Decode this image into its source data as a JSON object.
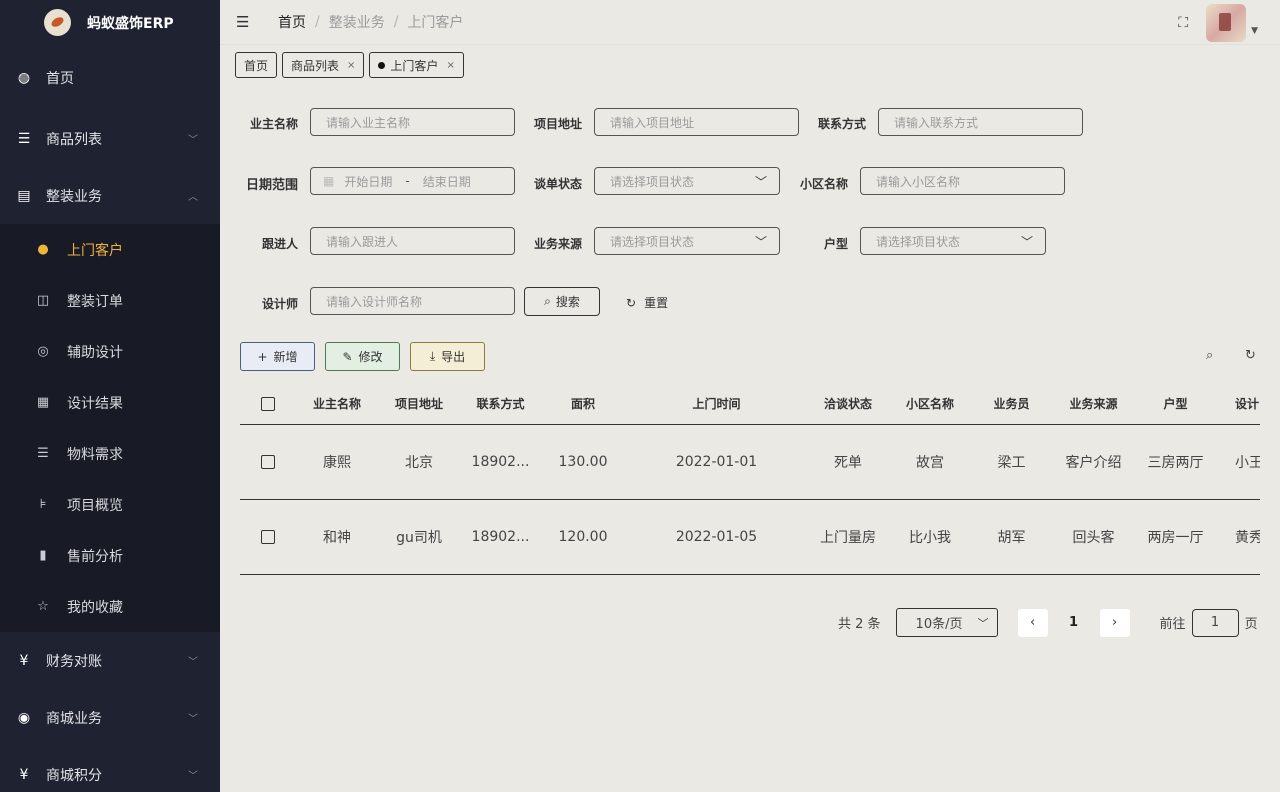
{
  "app": {
    "title": "蚂蚁盛饰ERP"
  },
  "sidebar": {
    "items": [
      {
        "label": "首页",
        "icon": "dashboard-icon",
        "arrow": ""
      },
      {
        "label": "商品列表",
        "icon": "list-icon",
        "arrow": "﹀"
      },
      {
        "label": "整装业务",
        "icon": "document-icon",
        "arrow": "︿"
      }
    ],
    "submenu": [
      {
        "label": "上门客户",
        "icon": "user-icon",
        "active": true
      },
      {
        "label": "整装订单",
        "icon": "book-icon"
      },
      {
        "label": "辅助设计",
        "icon": "palette-icon"
      },
      {
        "label": "设计结果",
        "icon": "grid-icon"
      },
      {
        "label": "物料需求",
        "icon": "list-icon"
      },
      {
        "label": "项目概览",
        "icon": "tree-icon"
      },
      {
        "label": "售前分析",
        "icon": "bar-chart-icon"
      },
      {
        "label": "我的收藏",
        "icon": "star-icon"
      }
    ],
    "items_after": [
      {
        "label": "财务对账",
        "icon": "yen-icon",
        "arrow": "﹀"
      },
      {
        "label": "商城业务",
        "icon": "globe-icon",
        "arrow": "﹀"
      },
      {
        "label": "商城积分",
        "icon": "yen-icon",
        "arrow": "﹀"
      }
    ]
  },
  "header": {
    "breadcrumb": [
      "首页",
      "整装业务",
      "上门客户"
    ]
  },
  "tags": [
    {
      "label": "首页"
    },
    {
      "label": "商品列表",
      "close": "×"
    },
    {
      "label": "上门客户",
      "close": "×",
      "active": true
    }
  ],
  "filters": {
    "owner_name": {
      "label": "业主名称",
      "placeholder": "请输入业主名称"
    },
    "project_address": {
      "label": "项目地址",
      "placeholder": "请输入项目地址"
    },
    "contact": {
      "label": "联系方式",
      "placeholder": "请输入联系方式"
    },
    "date_range": {
      "label": "日期范围",
      "start": "开始日期",
      "sep": "-",
      "end": "结束日期"
    },
    "deal_status": {
      "label": "谈单状态",
      "placeholder": "请选择项目状态"
    },
    "community": {
      "label": "小区名称",
      "placeholder": "请输入小区名称"
    },
    "follower": {
      "label": "跟进人",
      "placeholder": "请输入跟进人"
    },
    "source": {
      "label": "业务来源",
      "placeholder": "请选择项目状态"
    },
    "house_type": {
      "label": "户型",
      "placeholder": "请选择项目状态"
    },
    "designer": {
      "label": "设计师",
      "placeholder": "请输入设计师名称"
    },
    "search_label": "搜索",
    "reset_label": "重置"
  },
  "toolbar": {
    "add": "新增",
    "edit": "修改",
    "export": "导出"
  },
  "table": {
    "columns": [
      "业主名称",
      "项目地址",
      "联系方式",
      "面积",
      "上门时间",
      "洽谈状态",
      "小区名称",
      "业务员",
      "业务来源",
      "户型",
      "设计"
    ],
    "rows": [
      [
        "康熙",
        "北京",
        "18902...",
        "130.00",
        "2022-01-01",
        "死单",
        "故宫",
        "梁工",
        "客户介绍",
        "三房两厅",
        "小王"
      ],
      [
        "和神",
        "gu司机",
        "18902...",
        "120.00",
        "2022-01-05",
        "上门量房",
        "比小我",
        "胡军",
        "回头客",
        "两房一厅",
        "黄秀"
      ]
    ]
  },
  "pagination": {
    "total": "共 2 条",
    "page_size": "10条/页",
    "current": "1",
    "goto_label": "前往",
    "goto_value": "1",
    "page_suffix": "页"
  }
}
